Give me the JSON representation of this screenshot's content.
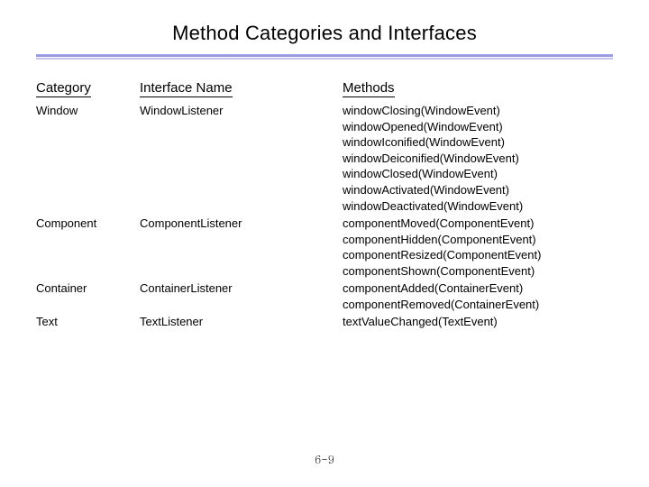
{
  "title": "Method Categories and Interfaces",
  "headers": {
    "category": "Category",
    "interface": "Interface Name",
    "methods": "Methods"
  },
  "rows": [
    {
      "category": "Window",
      "interface": "WindowListener",
      "methods": [
        "windowClosing(WindowEvent)",
        "windowOpened(WindowEvent)",
        "windowIconified(WindowEvent)",
        "windowDeiconified(WindowEvent)",
        "windowClosed(WindowEvent)",
        "windowActivated(WindowEvent)",
        "windowDeactivated(WindowEvent)"
      ]
    },
    {
      "category": "Component",
      "interface": "ComponentListener",
      "methods": [
        "componentMoved(ComponentEvent)",
        "componentHidden(ComponentEvent)",
        "componentResized(ComponentEvent)",
        "componentShown(ComponentEvent)"
      ]
    },
    {
      "category": "Container",
      "interface": "ContainerListener",
      "methods": [
        "componentAdded(ContainerEvent)",
        "componentRemoved(ContainerEvent)"
      ]
    },
    {
      "category": "Text",
      "interface": "TextListener",
      "methods": [
        "textValueChanged(TextEvent)"
      ]
    }
  ],
  "footer": "6-9"
}
